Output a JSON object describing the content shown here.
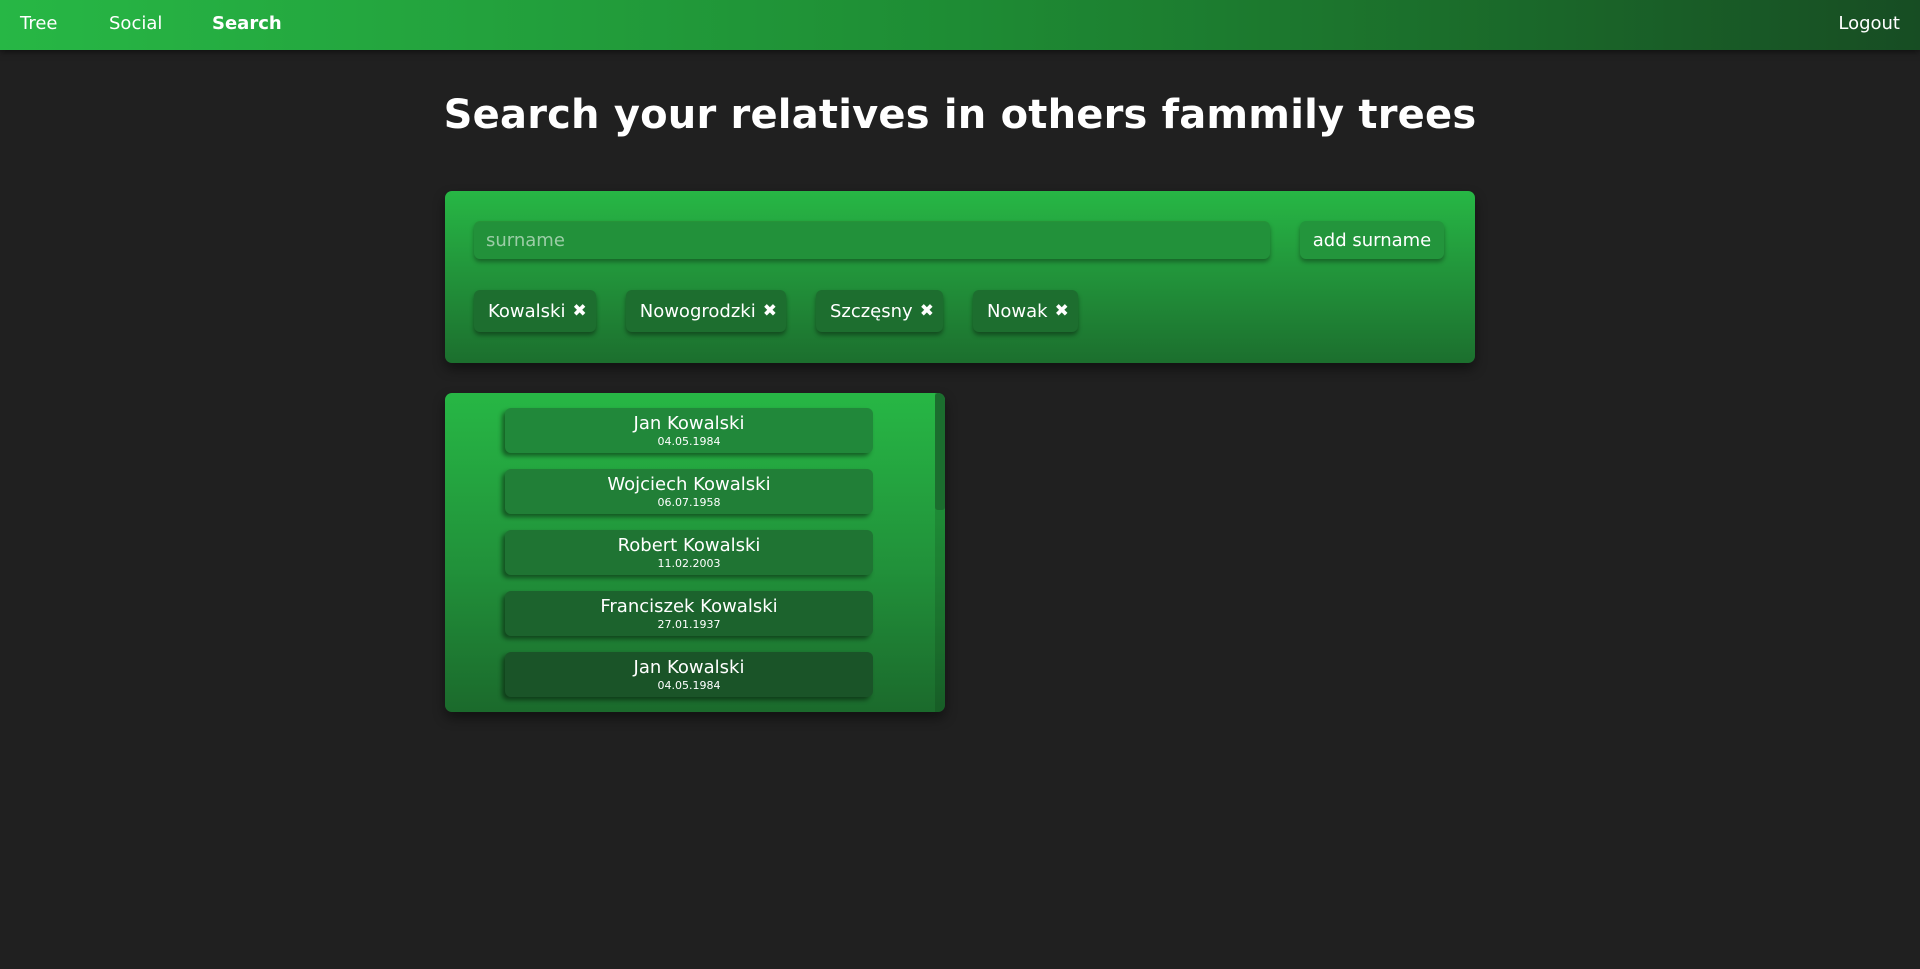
{
  "nav": {
    "tree": "Tree",
    "social": "Social",
    "search": "Search",
    "logout": "Logout",
    "active": "Search"
  },
  "title": "Search your relatives in others fammily trees",
  "search": {
    "placeholder": "surname",
    "value": "",
    "add_button_label": "add surname"
  },
  "tags": [
    {
      "label": "Kowalski",
      "remove_icon": "close-icon"
    },
    {
      "label": "Nowogrodzki",
      "remove_icon": "close-icon"
    },
    {
      "label": "Szczęsny",
      "remove_icon": "close-icon"
    },
    {
      "label": "Nowak",
      "remove_icon": "close-icon"
    }
  ],
  "tag_remove_glyph": "✖",
  "results": [
    {
      "name": "Jan Kowalski",
      "date": "04.05.1984"
    },
    {
      "name": "Wojciech Kowalski",
      "date": "06.07.1958"
    },
    {
      "name": "Robert Kowalski",
      "date": "11.02.2003"
    },
    {
      "name": "Franciszek Kowalski",
      "date": "27.01.1937"
    },
    {
      "name": "Jan Kowalski",
      "date": "04.05.1984"
    }
  ],
  "colors": {
    "background": "#202020",
    "accent": "#27b745",
    "accent_dark": "#174d23"
  }
}
